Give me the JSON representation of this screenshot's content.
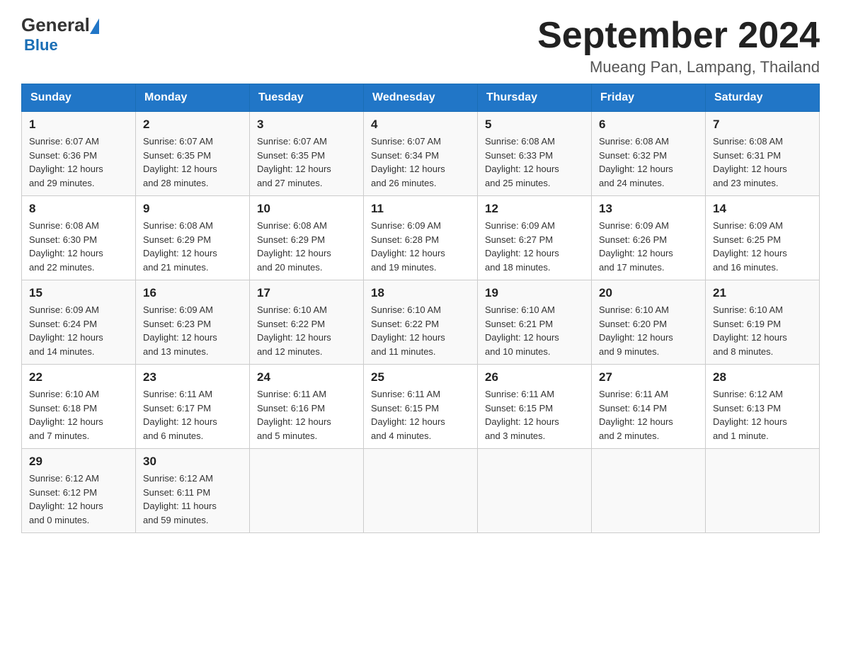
{
  "logo": {
    "general": "General",
    "blue": "Blue"
  },
  "header": {
    "title": "September 2024",
    "location": "Mueang Pan, Lampang, Thailand"
  },
  "days_of_week": [
    "Sunday",
    "Monday",
    "Tuesday",
    "Wednesday",
    "Thursday",
    "Friday",
    "Saturday"
  ],
  "weeks": [
    [
      {
        "day": "1",
        "sunrise": "6:07 AM",
        "sunset": "6:36 PM",
        "daylight": "12 hours and 29 minutes."
      },
      {
        "day": "2",
        "sunrise": "6:07 AM",
        "sunset": "6:35 PM",
        "daylight": "12 hours and 28 minutes."
      },
      {
        "day": "3",
        "sunrise": "6:07 AM",
        "sunset": "6:35 PM",
        "daylight": "12 hours and 27 minutes."
      },
      {
        "day": "4",
        "sunrise": "6:07 AM",
        "sunset": "6:34 PM",
        "daylight": "12 hours and 26 minutes."
      },
      {
        "day": "5",
        "sunrise": "6:08 AM",
        "sunset": "6:33 PM",
        "daylight": "12 hours and 25 minutes."
      },
      {
        "day": "6",
        "sunrise": "6:08 AM",
        "sunset": "6:32 PM",
        "daylight": "12 hours and 24 minutes."
      },
      {
        "day": "7",
        "sunrise": "6:08 AM",
        "sunset": "6:31 PM",
        "daylight": "12 hours and 23 minutes."
      }
    ],
    [
      {
        "day": "8",
        "sunrise": "6:08 AM",
        "sunset": "6:30 PM",
        "daylight": "12 hours and 22 minutes."
      },
      {
        "day": "9",
        "sunrise": "6:08 AM",
        "sunset": "6:29 PM",
        "daylight": "12 hours and 21 minutes."
      },
      {
        "day": "10",
        "sunrise": "6:08 AM",
        "sunset": "6:29 PM",
        "daylight": "12 hours and 20 minutes."
      },
      {
        "day": "11",
        "sunrise": "6:09 AM",
        "sunset": "6:28 PM",
        "daylight": "12 hours and 19 minutes."
      },
      {
        "day": "12",
        "sunrise": "6:09 AM",
        "sunset": "6:27 PM",
        "daylight": "12 hours and 18 minutes."
      },
      {
        "day": "13",
        "sunrise": "6:09 AM",
        "sunset": "6:26 PM",
        "daylight": "12 hours and 17 minutes."
      },
      {
        "day": "14",
        "sunrise": "6:09 AM",
        "sunset": "6:25 PM",
        "daylight": "12 hours and 16 minutes."
      }
    ],
    [
      {
        "day": "15",
        "sunrise": "6:09 AM",
        "sunset": "6:24 PM",
        "daylight": "12 hours and 14 minutes."
      },
      {
        "day": "16",
        "sunrise": "6:09 AM",
        "sunset": "6:23 PM",
        "daylight": "12 hours and 13 minutes."
      },
      {
        "day": "17",
        "sunrise": "6:10 AM",
        "sunset": "6:22 PM",
        "daylight": "12 hours and 12 minutes."
      },
      {
        "day": "18",
        "sunrise": "6:10 AM",
        "sunset": "6:22 PM",
        "daylight": "12 hours and 11 minutes."
      },
      {
        "day": "19",
        "sunrise": "6:10 AM",
        "sunset": "6:21 PM",
        "daylight": "12 hours and 10 minutes."
      },
      {
        "day": "20",
        "sunrise": "6:10 AM",
        "sunset": "6:20 PM",
        "daylight": "12 hours and 9 minutes."
      },
      {
        "day": "21",
        "sunrise": "6:10 AM",
        "sunset": "6:19 PM",
        "daylight": "12 hours and 8 minutes."
      }
    ],
    [
      {
        "day": "22",
        "sunrise": "6:10 AM",
        "sunset": "6:18 PM",
        "daylight": "12 hours and 7 minutes."
      },
      {
        "day": "23",
        "sunrise": "6:11 AM",
        "sunset": "6:17 PM",
        "daylight": "12 hours and 6 minutes."
      },
      {
        "day": "24",
        "sunrise": "6:11 AM",
        "sunset": "6:16 PM",
        "daylight": "12 hours and 5 minutes."
      },
      {
        "day": "25",
        "sunrise": "6:11 AM",
        "sunset": "6:15 PM",
        "daylight": "12 hours and 4 minutes."
      },
      {
        "day": "26",
        "sunrise": "6:11 AM",
        "sunset": "6:15 PM",
        "daylight": "12 hours and 3 minutes."
      },
      {
        "day": "27",
        "sunrise": "6:11 AM",
        "sunset": "6:14 PM",
        "daylight": "12 hours and 2 minutes."
      },
      {
        "day": "28",
        "sunrise": "6:12 AM",
        "sunset": "6:13 PM",
        "daylight": "12 hours and 1 minute."
      }
    ],
    [
      {
        "day": "29",
        "sunrise": "6:12 AM",
        "sunset": "6:12 PM",
        "daylight": "12 hours and 0 minutes."
      },
      {
        "day": "30",
        "sunrise": "6:12 AM",
        "sunset": "6:11 PM",
        "daylight": "11 hours and 59 minutes."
      },
      null,
      null,
      null,
      null,
      null
    ]
  ],
  "labels": {
    "sunrise": "Sunrise:",
    "sunset": "Sunset:",
    "daylight": "Daylight:"
  }
}
